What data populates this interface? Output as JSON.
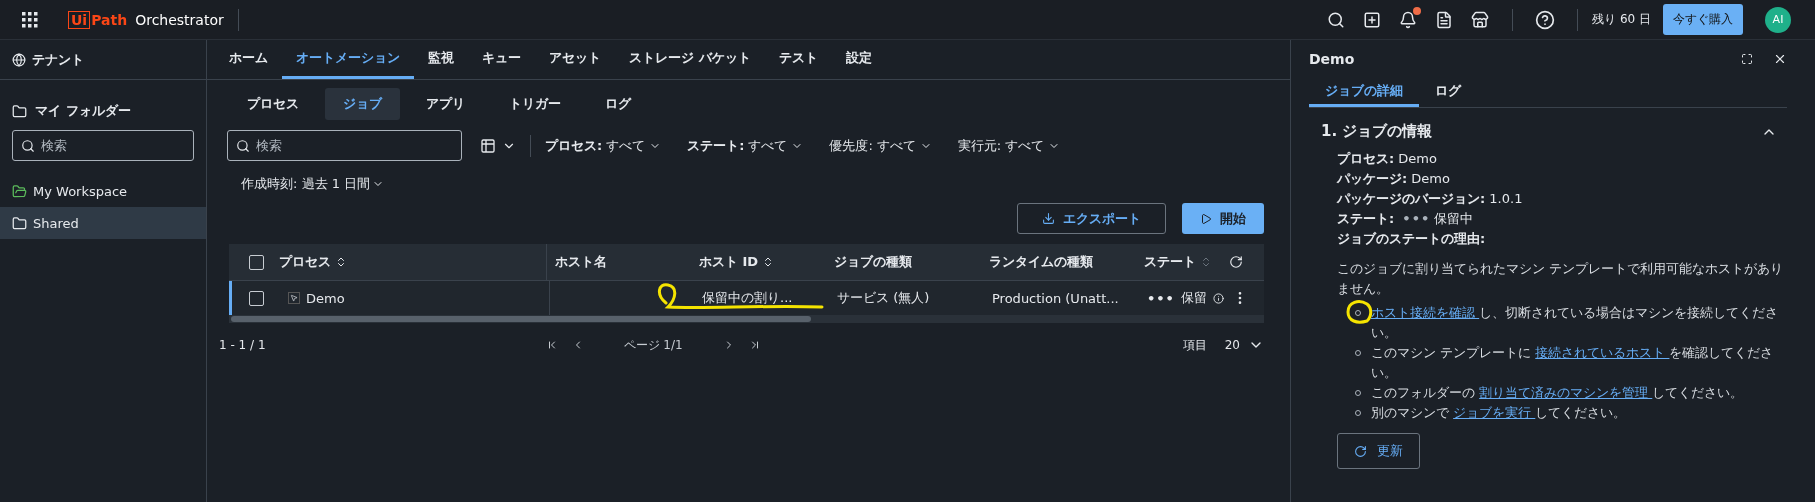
{
  "topbar": {
    "logo_prefix": "Ui",
    "logo_suffix": "Path",
    "product": "Orchestrator",
    "notification": true,
    "trial": "残り 60 日",
    "buy_button": "今すぐ購入",
    "avatar": "AI"
  },
  "sidebar": {
    "tenant": "テナント",
    "folder_header": "マイ フォルダー",
    "search": {
      "placeholder": "検索"
    },
    "items": [
      {
        "label": "My Workspace",
        "kind": "personal",
        "selected": false
      },
      {
        "label": "Shared",
        "kind": "folder",
        "selected": true
      }
    ]
  },
  "tabs": [
    {
      "label": "ホーム",
      "selected": false
    },
    {
      "label": "オートメーション",
      "selected": true
    },
    {
      "label": "監視",
      "selected": false
    },
    {
      "label": "キュー",
      "selected": false
    },
    {
      "label": "アセット",
      "selected": false
    },
    {
      "label": "ストレージ バケット",
      "selected": false
    },
    {
      "label": "テスト",
      "selected": false
    },
    {
      "label": "設定",
      "selected": false
    }
  ],
  "subtabs": [
    {
      "label": "プロセス",
      "selected": false
    },
    {
      "label": "ジョブ",
      "selected": true
    },
    {
      "label": "アプリ",
      "selected": false
    },
    {
      "label": "トリガー",
      "selected": false
    },
    {
      "label": "ログ",
      "selected": false
    }
  ],
  "search": {
    "placeholder": "検索"
  },
  "filters": [
    {
      "label": "プロセス:",
      "value": "すべて",
      "bold": true
    },
    {
      "label": "ステート:",
      "value": "すべて",
      "bold": true
    },
    {
      "label": "優先度:",
      "value": "すべて",
      "bold": false
    },
    {
      "label": "実行元:",
      "value": "すべて",
      "bold": false
    }
  ],
  "time_filter": "作成時刻: 過去 1 日間",
  "actions": [
    {
      "label": "エクスポート",
      "kind": "secondary"
    },
    {
      "label": "開始",
      "kind": "primary"
    }
  ],
  "table": {
    "select_all_checked": false,
    "columns": [
      {
        "label": "プロセス",
        "sortable": true
      },
      {
        "label": "ホスト名",
        "sortable": false
      },
      {
        "label": "ホスト ID",
        "sortable": true
      },
      {
        "label": "ジョブの種類",
        "sortable": false
      },
      {
        "label": "ランタイムの種類",
        "sortable": false
      },
      {
        "label": "ステート",
        "sortable": true
      }
    ],
    "rows": [
      {
        "selected": true,
        "checked": false,
        "cells": [
          "Demo",
          "",
          "保留中の割り...",
          "サービス (無人)",
          "Production (Unatt..."
        ],
        "state_dots": "•••",
        "state": "保留"
      }
    ]
  },
  "pagination": {
    "range": "1 - 1 / 1",
    "page": "ページ 1/1",
    "items_label": "項目",
    "items_value": "20"
  },
  "panel": {
    "title": "Demo",
    "tabs": [
      {
        "label": "ジョブの詳細",
        "selected": true
      },
      {
        "label": "ログ",
        "selected": false
      }
    ],
    "section": {
      "title": "1. ジョブの情報",
      "expanded": true,
      "fields": [
        {
          "label": "プロセス:",
          "value": "Demo"
        },
        {
          "label": "パッケージ:",
          "value": "Demo"
        },
        {
          "label": "パッケージのバージョン:",
          "value": "1.0.1"
        },
        {
          "label": "ステート:",
          "dots": "•••",
          "value": "保留中"
        },
        {
          "label": "ジョブのステートの理由:"
        }
      ],
      "message": "このジョブに割り当てられたマシン テンプレートで利用可能なホストがありません。",
      "bullets": [
        {
          "parts": [
            {
              "text": "ホスト接続を確認 ",
              "kind": "link"
            },
            {
              "text": "し、切断されている場合はマシンを接続してください。",
              "kind": "text"
            }
          ]
        },
        {
          "parts": [
            {
              "text": "このマシン テンプレートに ",
              "kind": "text"
            },
            {
              "text": "接続されているホスト ",
              "kind": "link"
            },
            {
              "text": "を確認してください。",
              "kind": "text"
            }
          ]
        },
        {
          "parts": [
            {
              "text": "このフォルダーの ",
              "kind": "text"
            },
            {
              "text": "割り当て済みのマシンを管理 ",
              "kind": "link"
            },
            {
              "text": "してください。",
              "kind": "text"
            }
          ]
        },
        {
          "parts": [
            {
              "text": "別のマシンで ",
              "kind": "text"
            },
            {
              "text": "ジョブを実行 ",
              "kind": "link"
            },
            {
              "text": "してください。",
              "kind": "text"
            }
          ]
        }
      ],
      "refresh_button": "更新"
    }
  }
}
